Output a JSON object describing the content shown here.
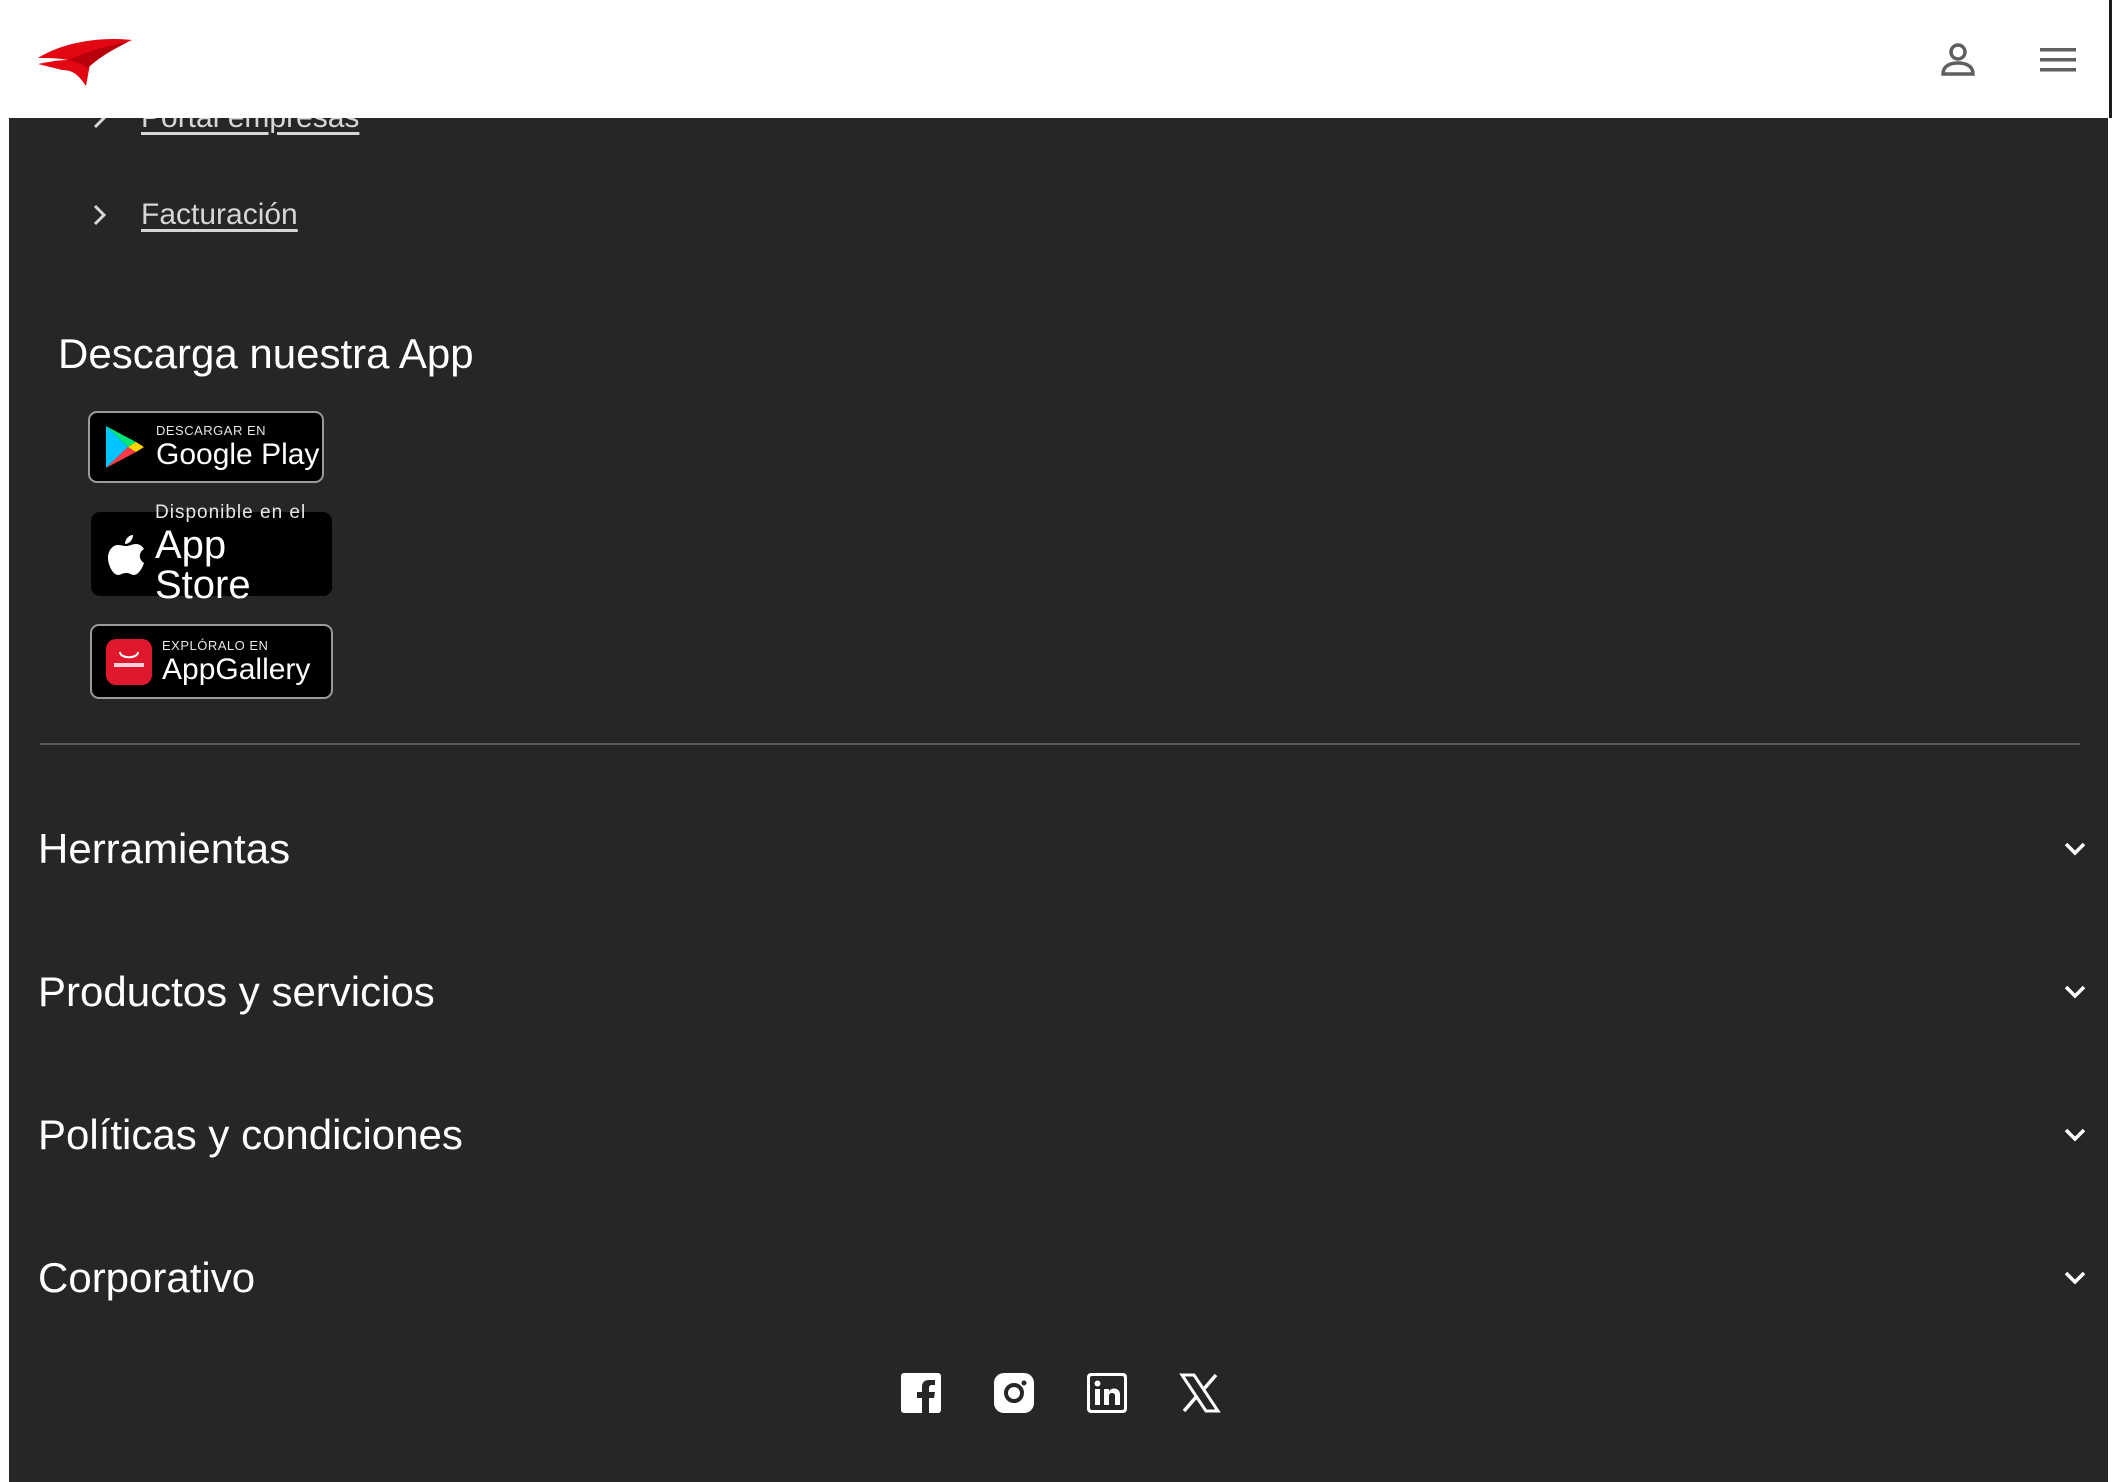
{
  "header": {
    "logo_icon": "red-bird-logo",
    "user_icon": "user-icon",
    "menu_icon": "hamburger-menu-icon"
  },
  "footer": {
    "links": [
      {
        "label": "Portal empresas"
      },
      {
        "label": "Facturación"
      }
    ],
    "app_section": {
      "title": "Descarga nuestra App",
      "google_play": {
        "small": "DESCARGAR EN",
        "big": "Google Play"
      },
      "app_store": {
        "small": "Disponible en el",
        "big": "App Store"
      },
      "app_gallery": {
        "small": "EXPLÓRALO EN",
        "big": "AppGallery"
      }
    },
    "sections": [
      {
        "title": "Herramientas"
      },
      {
        "title": "Productos y servicios"
      },
      {
        "title": "Políticas y condiciones"
      },
      {
        "title": "Corporativo"
      }
    ],
    "social": [
      "facebook-icon",
      "instagram-icon",
      "linkedin-icon",
      "x-icon"
    ]
  },
  "colors": {
    "brand_red": "#e30613",
    "footer_bg": "#262626",
    "text": "#ffffff",
    "link_text": "#d6d6d6"
  }
}
